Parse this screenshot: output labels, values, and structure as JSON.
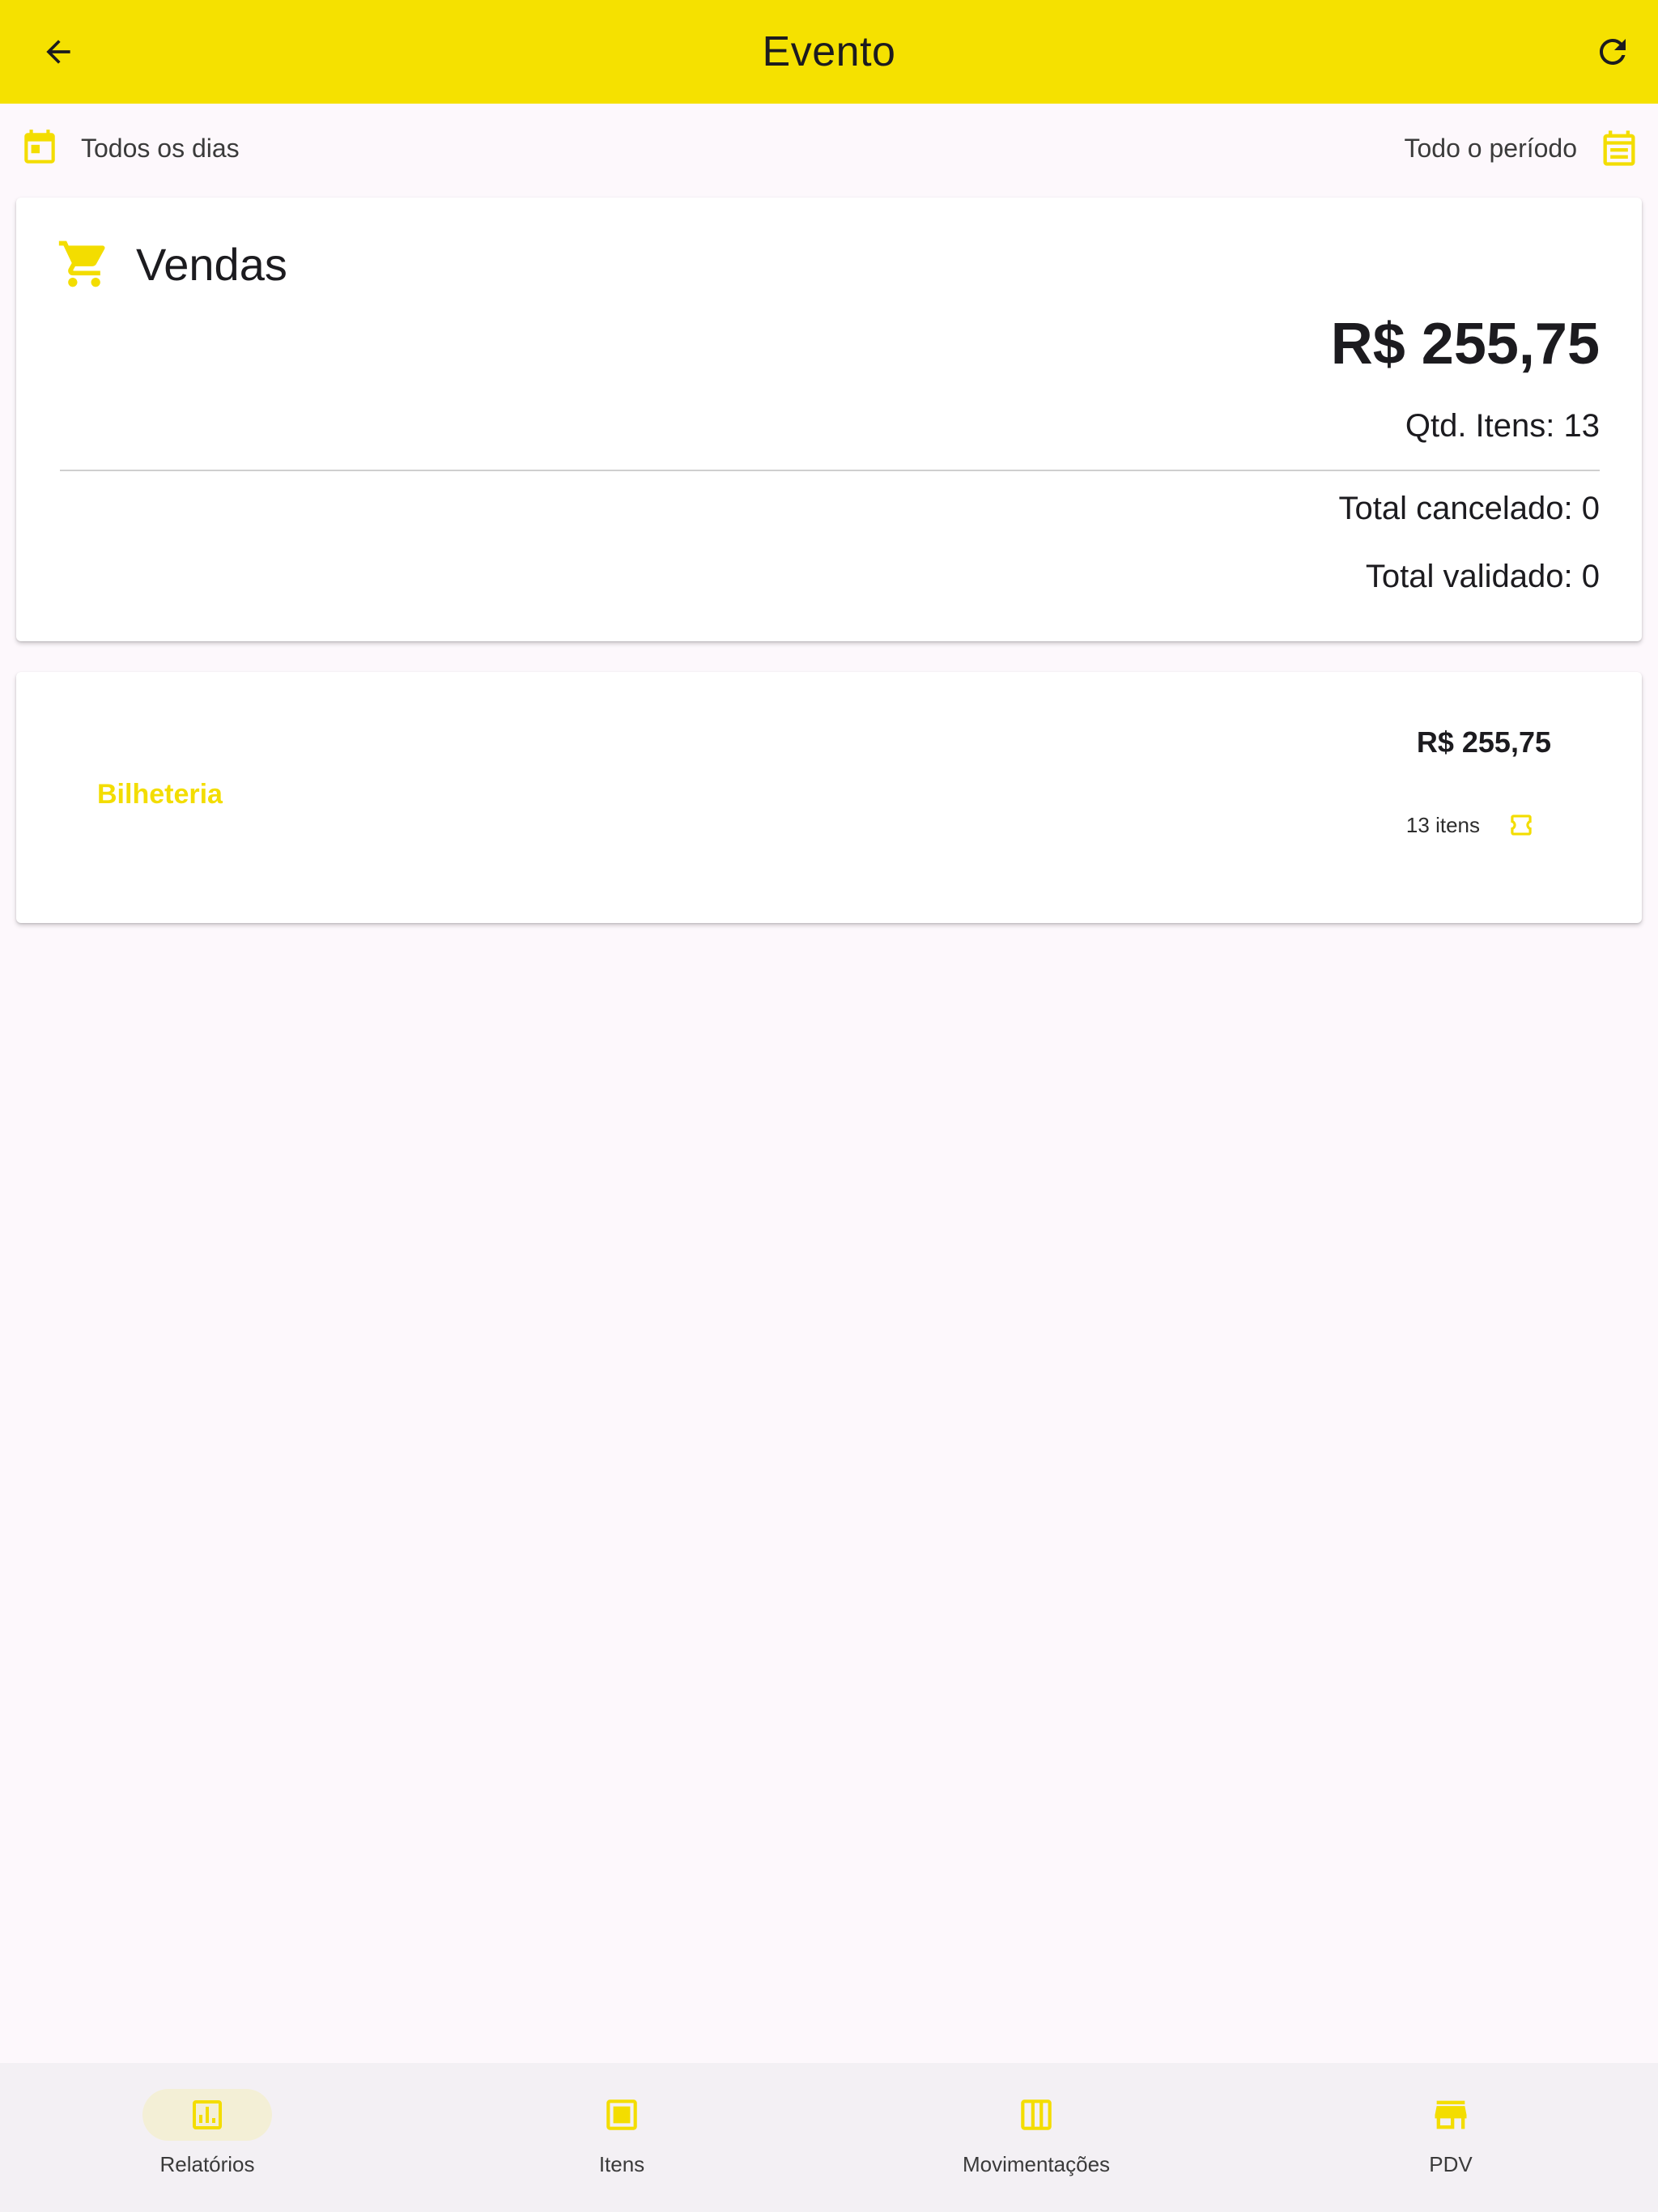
{
  "colors": {
    "accent": "#f5e100",
    "background": "#fdf8fc",
    "nav_background": "#f3f0f4"
  },
  "appbar": {
    "title": "Evento",
    "back_icon": "arrow-left-icon",
    "refresh_icon": "refresh-icon"
  },
  "filters": {
    "days": {
      "label": "Todos os dias",
      "icon": "calendar-today-icon"
    },
    "period": {
      "label": "Todo o período",
      "icon": "calendar-month-icon"
    }
  },
  "sales": {
    "title": "Vendas",
    "icon": "shopping-cart-icon",
    "total": "R$ 255,75",
    "qty": "Qtd. Itens: 13",
    "cancelled": "Total cancelado: 0",
    "validated": "Total validado: 0"
  },
  "channels": [
    {
      "name": "Bilheteria",
      "amount": "R$ 255,75",
      "items": "13 itens",
      "icon": "ticket-icon"
    }
  ],
  "nav": [
    {
      "label": "Relatórios",
      "icon": "chart-icon",
      "active": true
    },
    {
      "label": "Itens",
      "icon": "item-box-icon",
      "active": false
    },
    {
      "label": "Movimentações",
      "icon": "columns-icon",
      "active": false
    },
    {
      "label": "PDV",
      "icon": "store-icon",
      "active": false
    }
  ]
}
